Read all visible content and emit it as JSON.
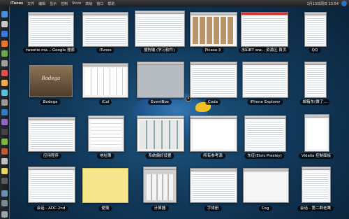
{
  "menubar": {
    "app_name": "iTunes",
    "menus": [
      "文件",
      "编辑",
      "显示",
      "控制",
      "Store",
      "高级",
      "窗口",
      "帮助"
    ],
    "clock": "1月13日周日 13:54"
  },
  "windows": [
    {
      "label": "tweetie ma... Google 搜索"
    },
    {
      "label": "iTunes"
    },
    {
      "label": "搜狗输 (学习软件)"
    },
    {
      "label": "Picasa 3"
    },
    {
      "label": "水缸BT ww... 资源区 首页"
    },
    {
      "label": "QQ"
    },
    {
      "label": "Bodega"
    },
    {
      "label": "iCal"
    },
    {
      "label": "EventBox"
    },
    {
      "label": "Coda"
    },
    {
      "label": "iPhone Explorer"
    },
    {
      "label": "邮箱东(微了..."
    },
    {
      "label": "应用程序"
    },
    {
      "label": "地址簿"
    },
    {
      "label": "系统偏好设置"
    },
    {
      "label": "所有参考源"
    },
    {
      "label": "东征(Elvis Presley)"
    },
    {
      "label": "Vidalia 控制面板"
    },
    {
      "label": "会话 - ADC-2nd"
    },
    {
      "label": "便笺"
    },
    {
      "label": "计算器"
    },
    {
      "label": "字体册"
    },
    {
      "label": "Cog"
    },
    {
      "label": "会话 - 第二群老鹰"
    }
  ],
  "bodega_title": "Bodega",
  "icons": {
    "apple": "apple-icon",
    "spotlight": "spotlight-icon",
    "close": "close-icon"
  }
}
